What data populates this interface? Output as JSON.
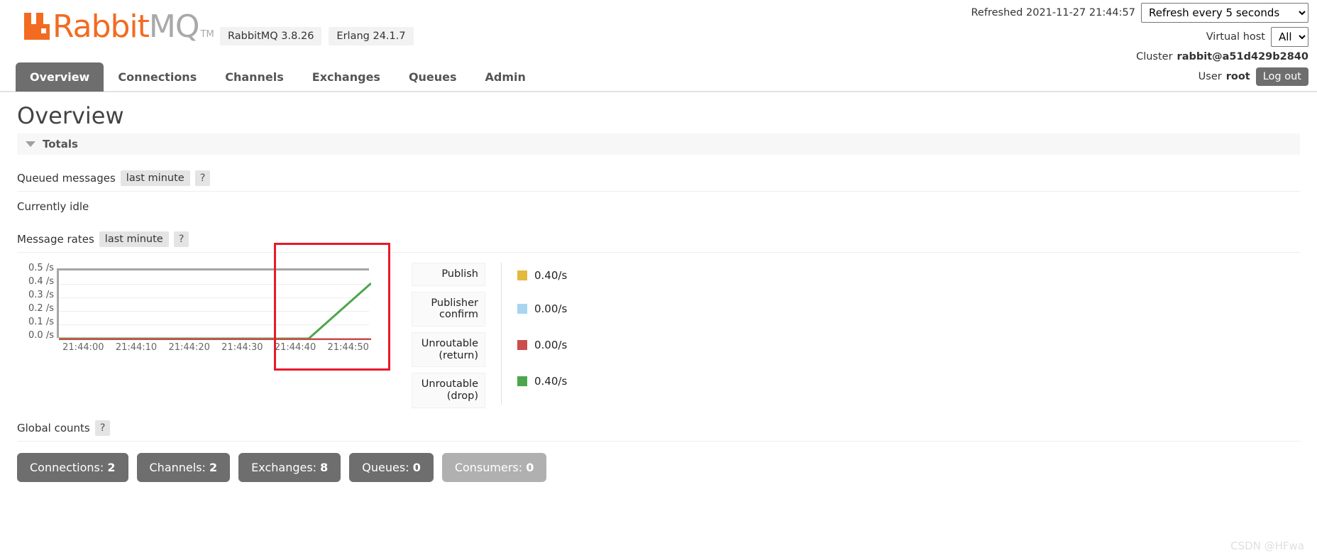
{
  "header": {
    "logo": {
      "part1": "Rabbit",
      "part2": "MQ",
      "tm": "TM",
      "icon": "rabbitmq-logo-icon"
    },
    "badges": [
      "RabbitMQ 3.8.26",
      "Erlang 24.1.7"
    ],
    "refreshed_label": "Refreshed 2021-11-27 21:44:57",
    "refresh_select_value": "Refresh every 5 seconds",
    "vhost_label": "Virtual host",
    "vhost_select_value": "All",
    "cluster_label": "Cluster",
    "cluster_name": "rabbit@a51d429b2840",
    "user_label": "User",
    "user_name": "root",
    "logout_label": "Log out"
  },
  "nav": {
    "items": [
      {
        "label": "Overview",
        "active": true
      },
      {
        "label": "Connections",
        "active": false
      },
      {
        "label": "Channels",
        "active": false
      },
      {
        "label": "Exchanges",
        "active": false
      },
      {
        "label": "Queues",
        "active": false
      },
      {
        "label": "Admin",
        "active": false
      }
    ]
  },
  "main": {
    "page_title": "Overview",
    "totals_label": "Totals",
    "queued_messages": {
      "label": "Queued messages",
      "period": "last minute",
      "help": "?",
      "status": "Currently idle"
    },
    "message_rates": {
      "label": "Message rates",
      "period": "last minute",
      "help": "?"
    },
    "global_counts": {
      "label": "Global counts",
      "help": "?",
      "items": [
        {
          "label": "Connections:",
          "value": "2",
          "muted": false
        },
        {
          "label": "Channels:",
          "value": "2",
          "muted": false
        },
        {
          "label": "Exchanges:",
          "value": "8",
          "muted": false
        },
        {
          "label": "Queues:",
          "value": "0",
          "muted": false
        },
        {
          "label": "Consumers:",
          "value": "0",
          "muted": true
        }
      ]
    }
  },
  "chart_data": {
    "type": "line",
    "title": "Message rates",
    "xlabel": "",
    "ylabel": "/s",
    "ylim": [
      0.0,
      0.5
    ],
    "grid": true,
    "legend_position": "right",
    "y_ticks": [
      "0.5 /s",
      "0.4 /s",
      "0.3 /s",
      "0.2 /s",
      "0.1 /s",
      "0.0 /s"
    ],
    "x_ticks": [
      "21:44:00",
      "21:44:10",
      "21:44:20",
      "21:44:30",
      "21:44:40",
      "21:44:50"
    ],
    "x": [
      0,
      10,
      20,
      30,
      40,
      50
    ],
    "series": [
      {
        "name": "Publish",
        "color": "#e5b83e",
        "values": [
          0.0,
          0.0,
          0.0,
          0.0,
          0.0,
          0.4
        ],
        "rate": "0.40/s"
      },
      {
        "name": "Publisher confirm",
        "color": "#a8d5f0",
        "values": [
          0.0,
          0.0,
          0.0,
          0.0,
          0.0,
          0.0
        ],
        "rate": "0.00/s"
      },
      {
        "name": "Unroutable (return)",
        "color": "#cc4c4c",
        "values": [
          0.0,
          0.0,
          0.0,
          0.0,
          0.0,
          0.0
        ],
        "rate": "0.00/s"
      },
      {
        "name": "Unroutable (drop)",
        "color": "#4ca64c",
        "values": [
          0.0,
          0.0,
          0.0,
          0.0,
          0.0,
          0.4
        ],
        "rate": "0.40/s"
      }
    ],
    "annotation": {
      "type": "rectangle",
      "color": "#e8192c",
      "x_range": [
        "21:44:35",
        "21:44:55"
      ]
    }
  },
  "watermark": "CSDN @HFwa"
}
